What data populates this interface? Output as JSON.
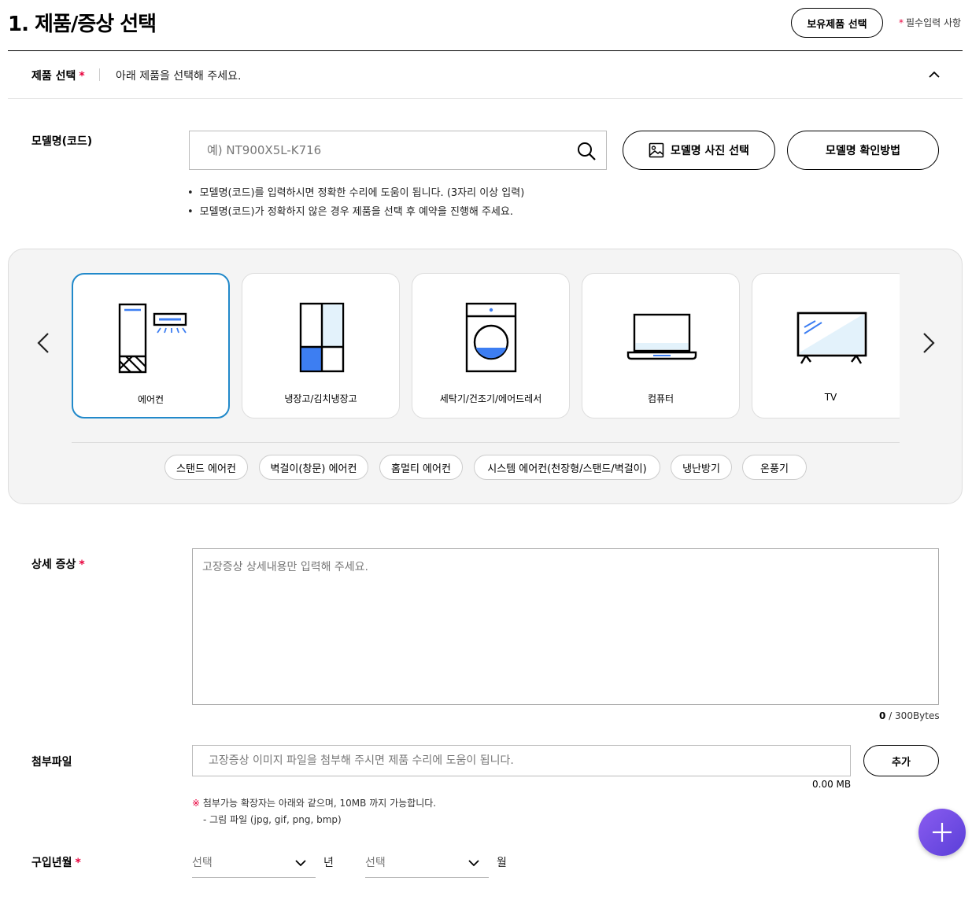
{
  "header": {
    "title": "1. 제품/증상 선택",
    "owned_products_button": "보유제품 선택",
    "required_star": "*",
    "required_note": "필수입력 사항"
  },
  "product_select": {
    "label": "제품 선택",
    "required_star": "*",
    "hint": "아래 제품을 선택해 주세요."
  },
  "model": {
    "label": "모델명(코드)",
    "placeholder": "예) NT900X5L-K716",
    "value": "",
    "photo_button": "모델명 사진 선택",
    "howto_button": "모델명 확인방법",
    "notes": [
      "모델명(코드)를 입력하시면 정확한 수리에 도움이 됩니다. (3자리 이상 입력)",
      "모델명(코드)가 정확하지 않은 경우 제품을 선택 후 예약을 진행해 주세요."
    ]
  },
  "categories": {
    "items": [
      {
        "label": "에어컨",
        "icon": "air-conditioner-icon",
        "selected": true
      },
      {
        "label": "냉장고/김치냉장고",
        "icon": "refrigerator-icon",
        "selected": false
      },
      {
        "label": "세탁기/건조기/에어드레서",
        "icon": "washing-machine-icon",
        "selected": false
      },
      {
        "label": "컴퓨터",
        "icon": "laptop-icon",
        "selected": false
      },
      {
        "label": "TV",
        "icon": "tv-icon",
        "selected": false
      }
    ],
    "subcategories": [
      "스탠드 에어컨",
      "벽걸이(창문) 에어컨",
      "홈멀티 에어컨",
      "시스템 에어컨(천장형/스탠드/벽걸이)",
      "냉난방기",
      "온풍기"
    ]
  },
  "symptom": {
    "label": "상세 증상",
    "required_star": "*",
    "placeholder": "고장증상 상세내용만 입력해 주세요.",
    "byte_count": "0",
    "byte_limit": "/ 300Bytes"
  },
  "attachment": {
    "label": "첨부파일",
    "placeholder": "고장증상 이미지 파일을 첨부해 주시면 제품 수리에 도움이 됩니다.",
    "add_button": "추가",
    "size": "0.00 MB",
    "note_mark": "※",
    "note_line1": "첨부가능 확장자는 아래와 같으며, 10MB 까지 가능합니다.",
    "note_line2": "- 그림 파일 (jpg, gif, png, bmp)"
  },
  "purchase": {
    "label": "구입년월",
    "required_star": "*",
    "year_select": "선택",
    "year_unit": "년",
    "month_select": "선택",
    "month_unit": "월"
  },
  "colors": {
    "accent": "#2189ca",
    "required": "#e8003c",
    "fab": "#6b4ee6"
  }
}
